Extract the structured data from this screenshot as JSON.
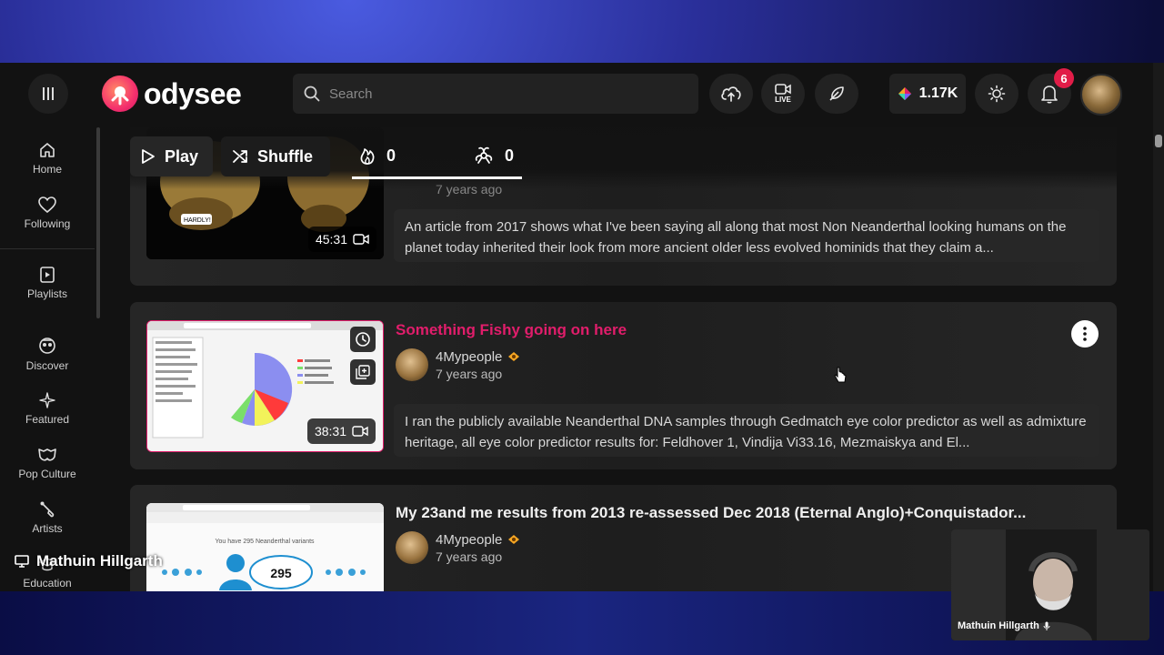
{
  "header": {
    "logo_text": "odysee",
    "search_placeholder": "Search",
    "live_label": "LIVE",
    "credits": "1.17K",
    "notification_count": "6"
  },
  "sidebar": {
    "items": [
      {
        "label": "Home",
        "icon": "home-icon"
      },
      {
        "label": "Following",
        "icon": "heart-icon"
      },
      {
        "label": "Playlists",
        "icon": "playlist-icon"
      },
      {
        "label": "Discover",
        "icon": "discover-icon"
      },
      {
        "label": "Featured",
        "icon": "star-icon"
      },
      {
        "label": "Pop Culture",
        "icon": "mask-icon"
      },
      {
        "label": "Artists",
        "icon": "brush-icon"
      },
      {
        "label": "Education",
        "icon": "education-icon"
      }
    ],
    "overlay_name": "Mathuin Hillgarth"
  },
  "toolbar": {
    "play_label": "Play",
    "shuffle_label": "Shuffle",
    "fire_count": "0",
    "reactions_count": "0"
  },
  "videos": [
    {
      "title": "",
      "time": "7 years ago",
      "duration": "45:31",
      "thumb_text": "HARDLY!",
      "description": "An article from 2017 shows what I've been saying all along that most Non Neanderthal looking humans on the planet today inherited their look from more ancient older less evolved hominids that they claim a..."
    },
    {
      "title": "Something Fishy going on here",
      "channel": "4Mypeople",
      "time": "7 years ago",
      "duration": "38:31",
      "description": "I ran the publicly available Neanderthal DNA samples through Gedmatch eye color predictor as well as admixture heritage, all eye color predictor results for: Feldhover 1, Vindija Vi33.16, Mezmaiskya and El..."
    },
    {
      "title": "My 23and me results from 2013 re-assessed Dec 2018 (Eternal Anglo)+Conquistador...",
      "channel": "4Mypeople",
      "time": "7 years ago",
      "thumb_headline": "You have 295 Neanderthal variants",
      "thumb_number": "295"
    }
  ],
  "webcam": {
    "label": "Mathuin Hillgarth"
  },
  "colors": {
    "accent": "#e11d6b",
    "badge": "#e11d48",
    "background": "#121212"
  }
}
